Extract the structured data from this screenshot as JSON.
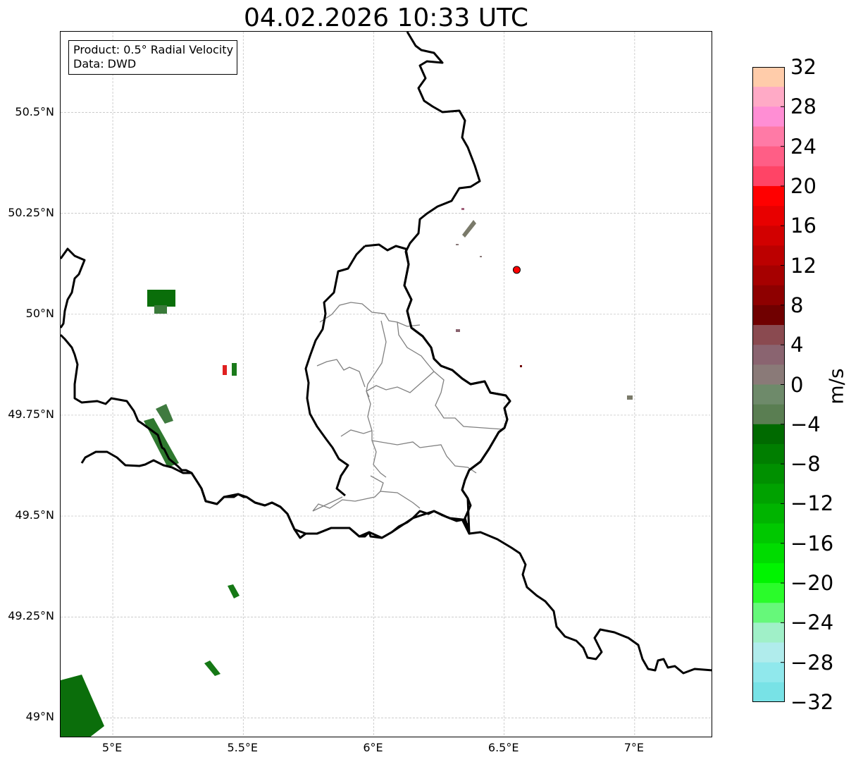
{
  "title": "04.02.2026 10:33 UTC",
  "info_box": {
    "product": "Product: 0.5° Radial Velocity",
    "source": "Data: DWD"
  },
  "map": {
    "lon_range": [
      4.8,
      7.3
    ],
    "lat_range": [
      48.95,
      50.7
    ],
    "lat_ticks": [
      {
        "value": 50.5,
        "label": "50.5°N"
      },
      {
        "value": 50.25,
        "label": "50.25°N"
      },
      {
        "value": 50.0,
        "label": "50°N"
      },
      {
        "value": 49.75,
        "label": "49.75°N"
      },
      {
        "value": 49.5,
        "label": "49.5°N"
      },
      {
        "value": 49.25,
        "label": "49.25°N"
      },
      {
        "value": 49.0,
        "label": "49°N"
      }
    ],
    "lon_ticks": [
      {
        "value": 5.0,
        "label": "5°E"
      },
      {
        "value": 5.5,
        "label": "5.5°E"
      },
      {
        "value": 6.0,
        "label": "6°E"
      },
      {
        "value": 6.5,
        "label": "6.5°E"
      },
      {
        "value": 7.0,
        "label": "7°E"
      }
    ],
    "grid": true,
    "radar_site": {
      "lon": 6.548,
      "lat": 50.11,
      "color": "#ff0000"
    },
    "colors": {
      "border": "#000000",
      "admin": "#808080",
      "grid": "#bbbbbb"
    }
  },
  "colorbar": {
    "unit": "m/s",
    "min": -32,
    "max": 32,
    "ticks": [
      {
        "value": 32,
        "label": "32"
      },
      {
        "value": 28,
        "label": "28"
      },
      {
        "value": 24,
        "label": "24"
      },
      {
        "value": 20,
        "label": "20"
      },
      {
        "value": 16,
        "label": "16"
      },
      {
        "value": 12,
        "label": "12"
      },
      {
        "value": 8,
        "label": "8"
      },
      {
        "value": 4,
        "label": "4"
      },
      {
        "value": 0,
        "label": "0"
      },
      {
        "value": -4,
        "label": "−4"
      },
      {
        "value": -8,
        "label": "−8"
      },
      {
        "value": -12,
        "label": "−12"
      },
      {
        "value": -16,
        "label": "−16"
      },
      {
        "value": -20,
        "label": "−20"
      },
      {
        "value": -24,
        "label": "−24"
      },
      {
        "value": -28,
        "label": "−28"
      },
      {
        "value": -32,
        "label": "−32"
      }
    ],
    "bands_top_to_bottom": [
      "#ffccaa",
      "#ffaac6",
      "#ff8ed4",
      "#ff7aa6",
      "#ff5e86",
      "#ff4466",
      "#ff0000",
      "#e80000",
      "#d20000",
      "#bc0000",
      "#a60000",
      "#8e0000",
      "#700000",
      "#8a4a50",
      "#8a6470",
      "#8a7a78",
      "#6e8a6a",
      "#5a7e52",
      "#006a00",
      "#007e00",
      "#009000",
      "#00a200",
      "#00b400",
      "#00c800",
      "#00dc00",
      "#00f400",
      "#2afc2a",
      "#66f87a",
      "#a0f0c8",
      "#b0ecec",
      "#90e8ec",
      "#78e2e6"
    ]
  }
}
